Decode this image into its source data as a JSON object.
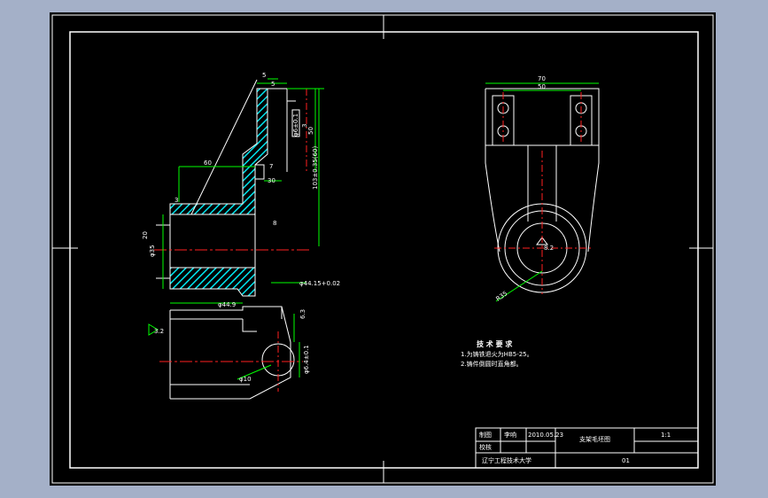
{
  "colors": {
    "background": "#a4b0c8",
    "canvas": "#000000",
    "line": "#ffffff",
    "hatch": "#00e5ee",
    "dimension": "#00ff00",
    "centerline": "#ff2020",
    "text": "#ffffff"
  },
  "left_view": {
    "dims": {
      "top_width": "5",
      "step_width": "5",
      "thickness_note": "3",
      "hole_dia": "φ6±0.1",
      "depth": "50",
      "total_height": "103±0.35(60)",
      "inner_width": "7",
      "inner_step": "30",
      "chamfer": "3",
      "angle": "60",
      "left_dim": "20",
      "bore_dia": "φ35",
      "right_dim": "8",
      "bottom_dim": "φ44.15+0.02"
    }
  },
  "bottom_view": {
    "dims": {
      "top_len": "φ44.9",
      "top_right": "6.3",
      "roughness": "3.2",
      "hole": "φ10",
      "right_side": "φ6.4±0.1"
    }
  },
  "right_view": {
    "dims": {
      "outer_width": "70",
      "inner_width": "50",
      "center_label": "8.2",
      "radius": "R35"
    }
  },
  "notes": {
    "title": "技 术 要 求",
    "lines": [
      "1.为铸铁退火为HB5-25。",
      "2.铸件倒圆时直角都。"
    ]
  },
  "title_block": {
    "drawn_label": "制图",
    "drawn_name": "李响",
    "drawn_date": "2010.05.23",
    "checked_label": "校核",
    "part_name": "支架毛坯图",
    "scale": "1:1",
    "school": "辽宁工程技术大学",
    "drawing_no": "01"
  }
}
